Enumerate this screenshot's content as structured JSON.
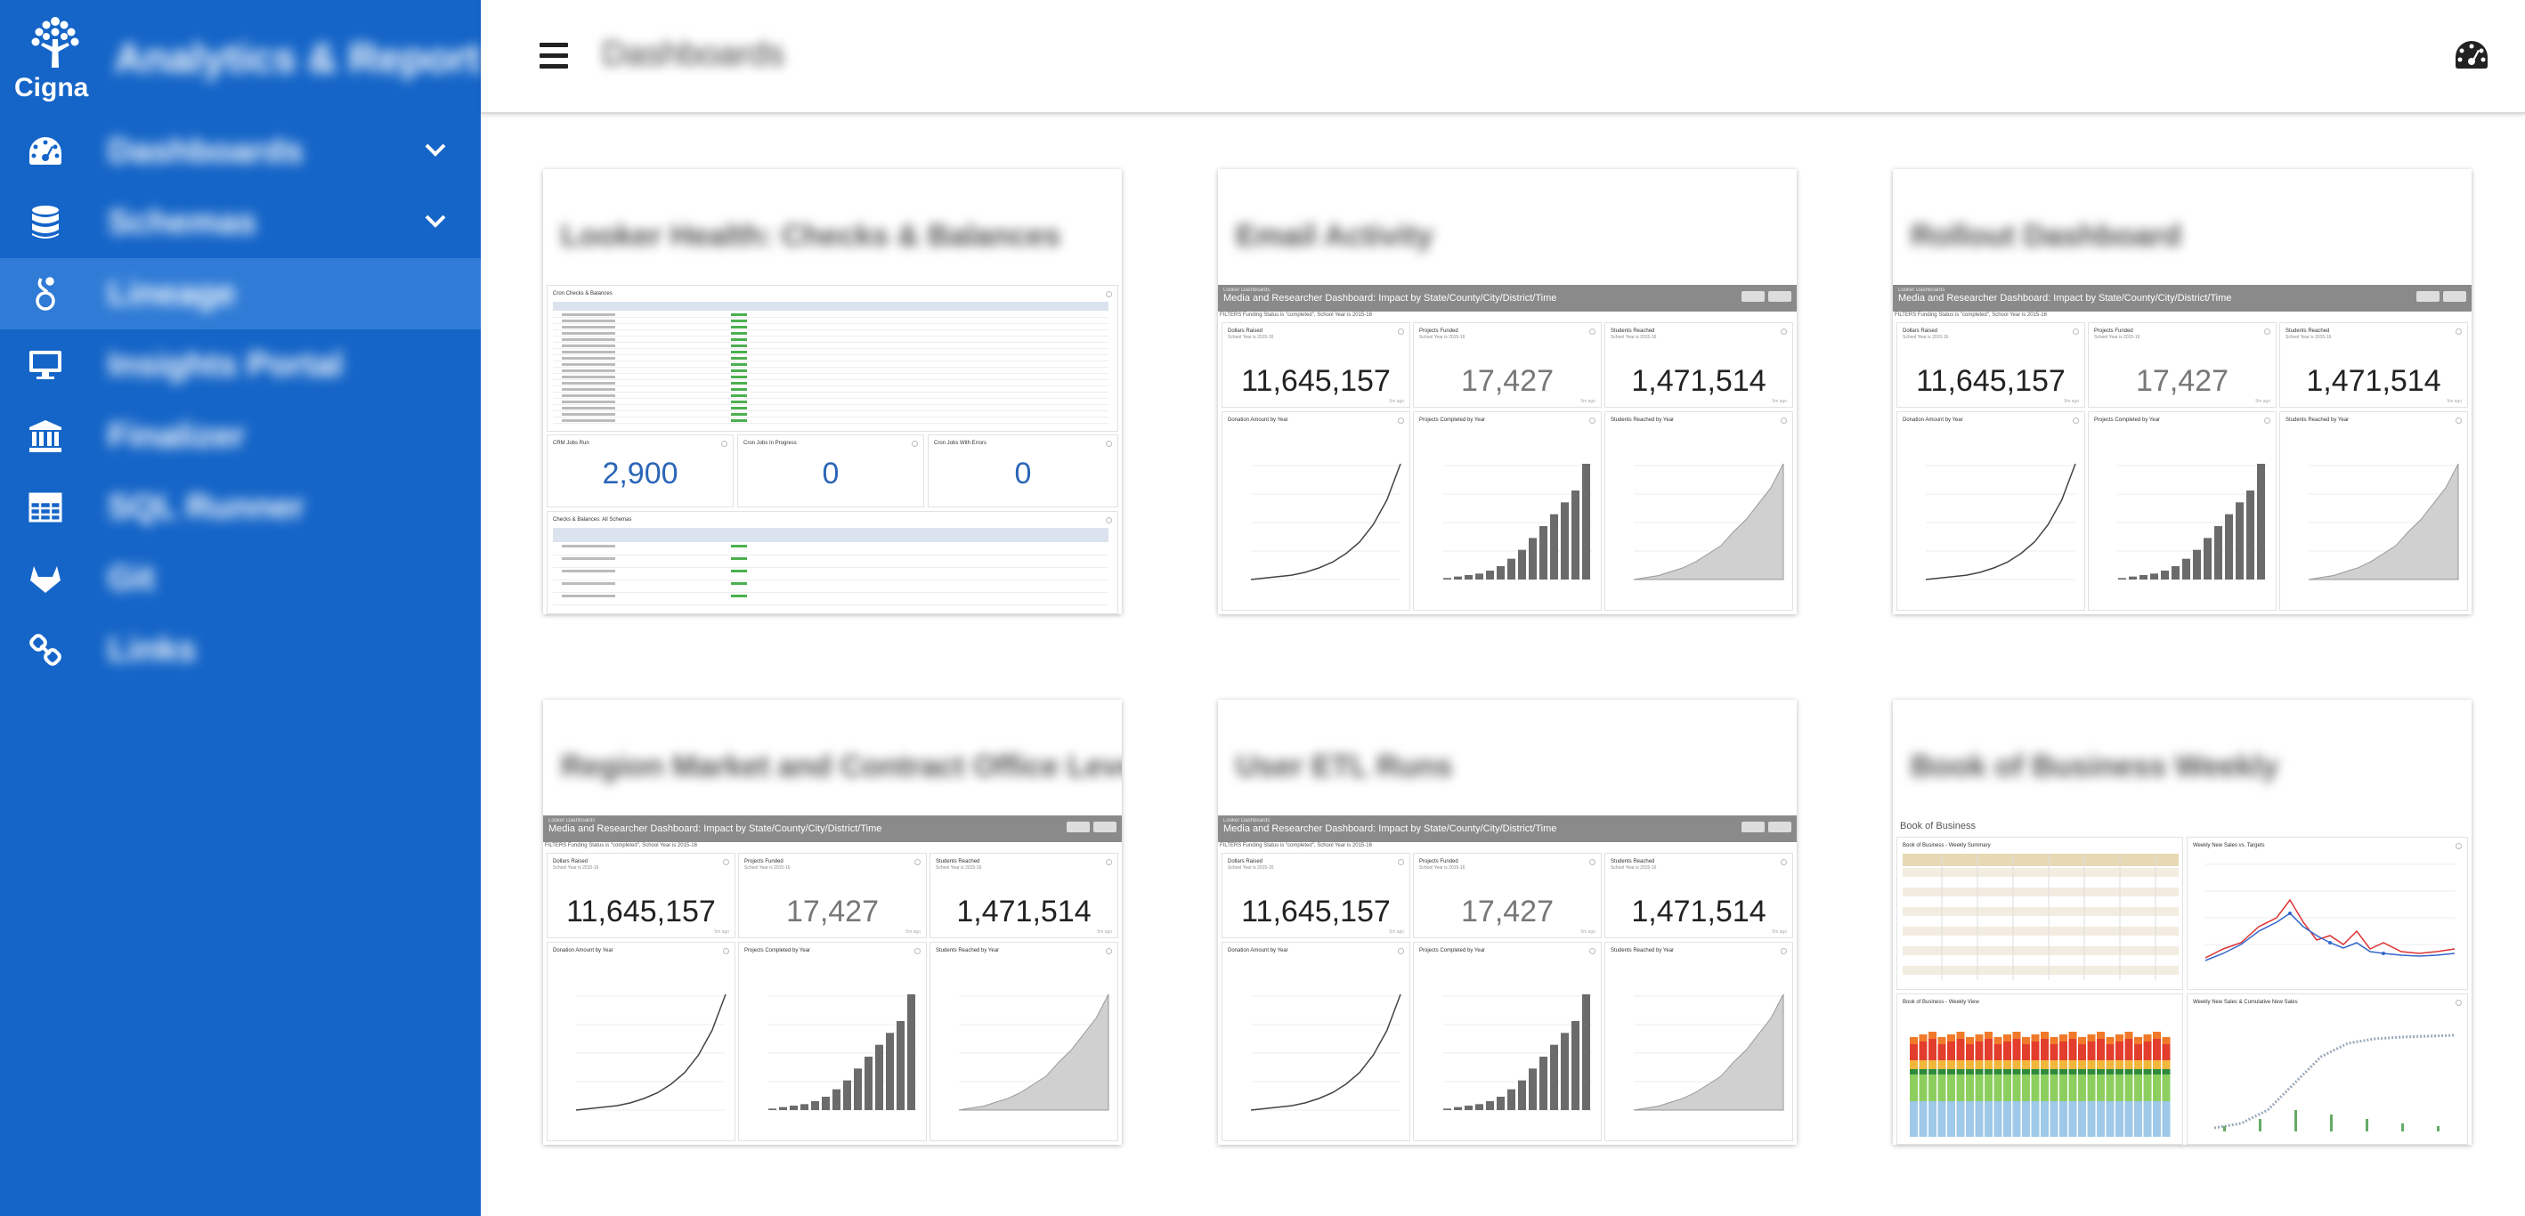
{
  "brand": {
    "logo_text": "Cigna",
    "app_title": "Analytics & Reporting"
  },
  "nav": {
    "items": [
      {
        "label": "Dashboards",
        "icon": "speedometer-icon",
        "has_chevron": true
      },
      {
        "label": "Schemas",
        "icon": "database-icon",
        "has_chevron": true
      },
      {
        "label": "Lineage",
        "icon": "lineage-icon",
        "has_chevron": false,
        "active": true
      },
      {
        "label": "Insights Portal",
        "icon": "monitor-icon",
        "has_chevron": false
      },
      {
        "label": "Finalizer",
        "icon": "bank-icon",
        "has_chevron": false
      },
      {
        "label": "SQL Runner",
        "icon": "table-icon",
        "has_chevron": false
      },
      {
        "label": "Git",
        "icon": "gitlab-icon",
        "has_chevron": false
      },
      {
        "label": "Links",
        "icon": "link-icon",
        "has_chevron": false
      }
    ]
  },
  "header": {
    "page_title": "Dashboards"
  },
  "cards": [
    {
      "title": "Looker Health: Checks & Balances"
    },
    {
      "title": "Email Activity"
    },
    {
      "title": "Rollout Dashboard"
    },
    {
      "title": "Region Market and Contract Office Level"
    },
    {
      "title": "User ETL Runs"
    },
    {
      "title": "Book of Business Weekly"
    }
  ],
  "preview": {
    "header_small": "Looker Dashboards",
    "header": "Media and Researcher Dashboard: Impact by State/County/City/District/Time",
    "filter": "FILTERS Funding Status is \"completed\", School Year is 2015-16",
    "tiles": {
      "dollars_raised": {
        "label": "Dollars Raised",
        "sub": "School Year is 2015-16",
        "value": "11,645,157"
      },
      "projects_funded": {
        "label": "Projects Funded",
        "sub": "School Year is 2015-16",
        "value": "17,427"
      },
      "students_reached": {
        "label": "Students Reached",
        "sub": "School Year is 2015-16",
        "value": "1,471,514"
      },
      "donation_amount": {
        "label": "Donation Amount by Year"
      },
      "projects_completed": {
        "label": "Projects Completed by Year"
      },
      "students_by_year": {
        "label": "Students Reached by Year"
      }
    },
    "footer": "5m ago"
  },
  "checks": {
    "section1": "Cron Checks & Balances",
    "jobs_run_label": "CRM Jobs Run",
    "jobs_run_value": "2,900",
    "in_progress_label": "Cron Jobs In Progress",
    "in_progress_value": "0",
    "errors_label": "Cron Jobs With Errors",
    "errors_value": "0",
    "section2": "Checks & Balances: All Schemas"
  },
  "bob": {
    "title": "Book of Business",
    "t1": "Book of Business - Weekly Summary",
    "t2": "Weekly New Sales vs. Targets",
    "t3": "Book of Business - Weekly View",
    "t4": "Weekly New Sales & Cumulative New Sales"
  },
  "chart_data": [
    {
      "type": "line",
      "title": "Donation Amount by Year",
      "values": [
        0,
        1,
        2,
        3,
        5,
        8,
        12,
        18,
        26,
        38,
        55,
        80
      ]
    },
    {
      "type": "bar",
      "title": "Projects Completed by Year",
      "values": [
        1,
        2,
        3,
        4,
        6,
        9,
        14,
        20,
        28,
        36,
        44,
        52,
        60,
        78
      ]
    },
    {
      "type": "area",
      "title": "Students Reached by Year",
      "values": [
        0,
        1,
        2,
        4,
        6,
        9,
        13,
        17,
        24,
        30,
        38,
        46,
        58
      ]
    }
  ],
  "colors": {
    "sidebar": "#1565c8",
    "sidebar_active": "#2f7bd6",
    "accent_blue": "#2b66b8"
  }
}
